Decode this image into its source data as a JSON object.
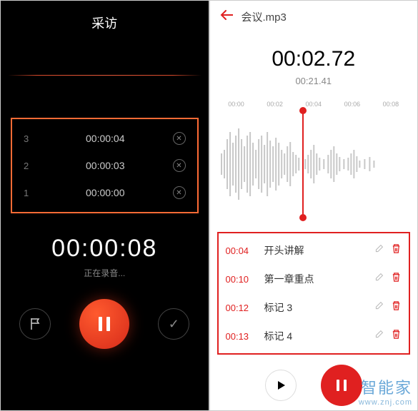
{
  "left": {
    "title": "采访",
    "marks": [
      {
        "index": "3",
        "time": "00:00:04"
      },
      {
        "index": "2",
        "time": "00:00:03"
      },
      {
        "index": "1",
        "time": "00:00:00"
      }
    ],
    "timer": "00:00:08",
    "status": "正在录音..."
  },
  "right": {
    "filename": "会议.mp3",
    "current": "00:02.72",
    "total": "00:21.41",
    "ticks": [
      "00:00",
      "00:02",
      "00:04",
      "00:06",
      "00:08"
    ],
    "tags": [
      {
        "time": "00:04",
        "label": "开头讲解"
      },
      {
        "time": "00:10",
        "label": "第一章重点"
      },
      {
        "time": "00:12",
        "label": "标记 3"
      },
      {
        "time": "00:13",
        "label": "标记 4"
      }
    ]
  },
  "watermark": {
    "brand": "智能家",
    "url": "www.znj.com"
  }
}
